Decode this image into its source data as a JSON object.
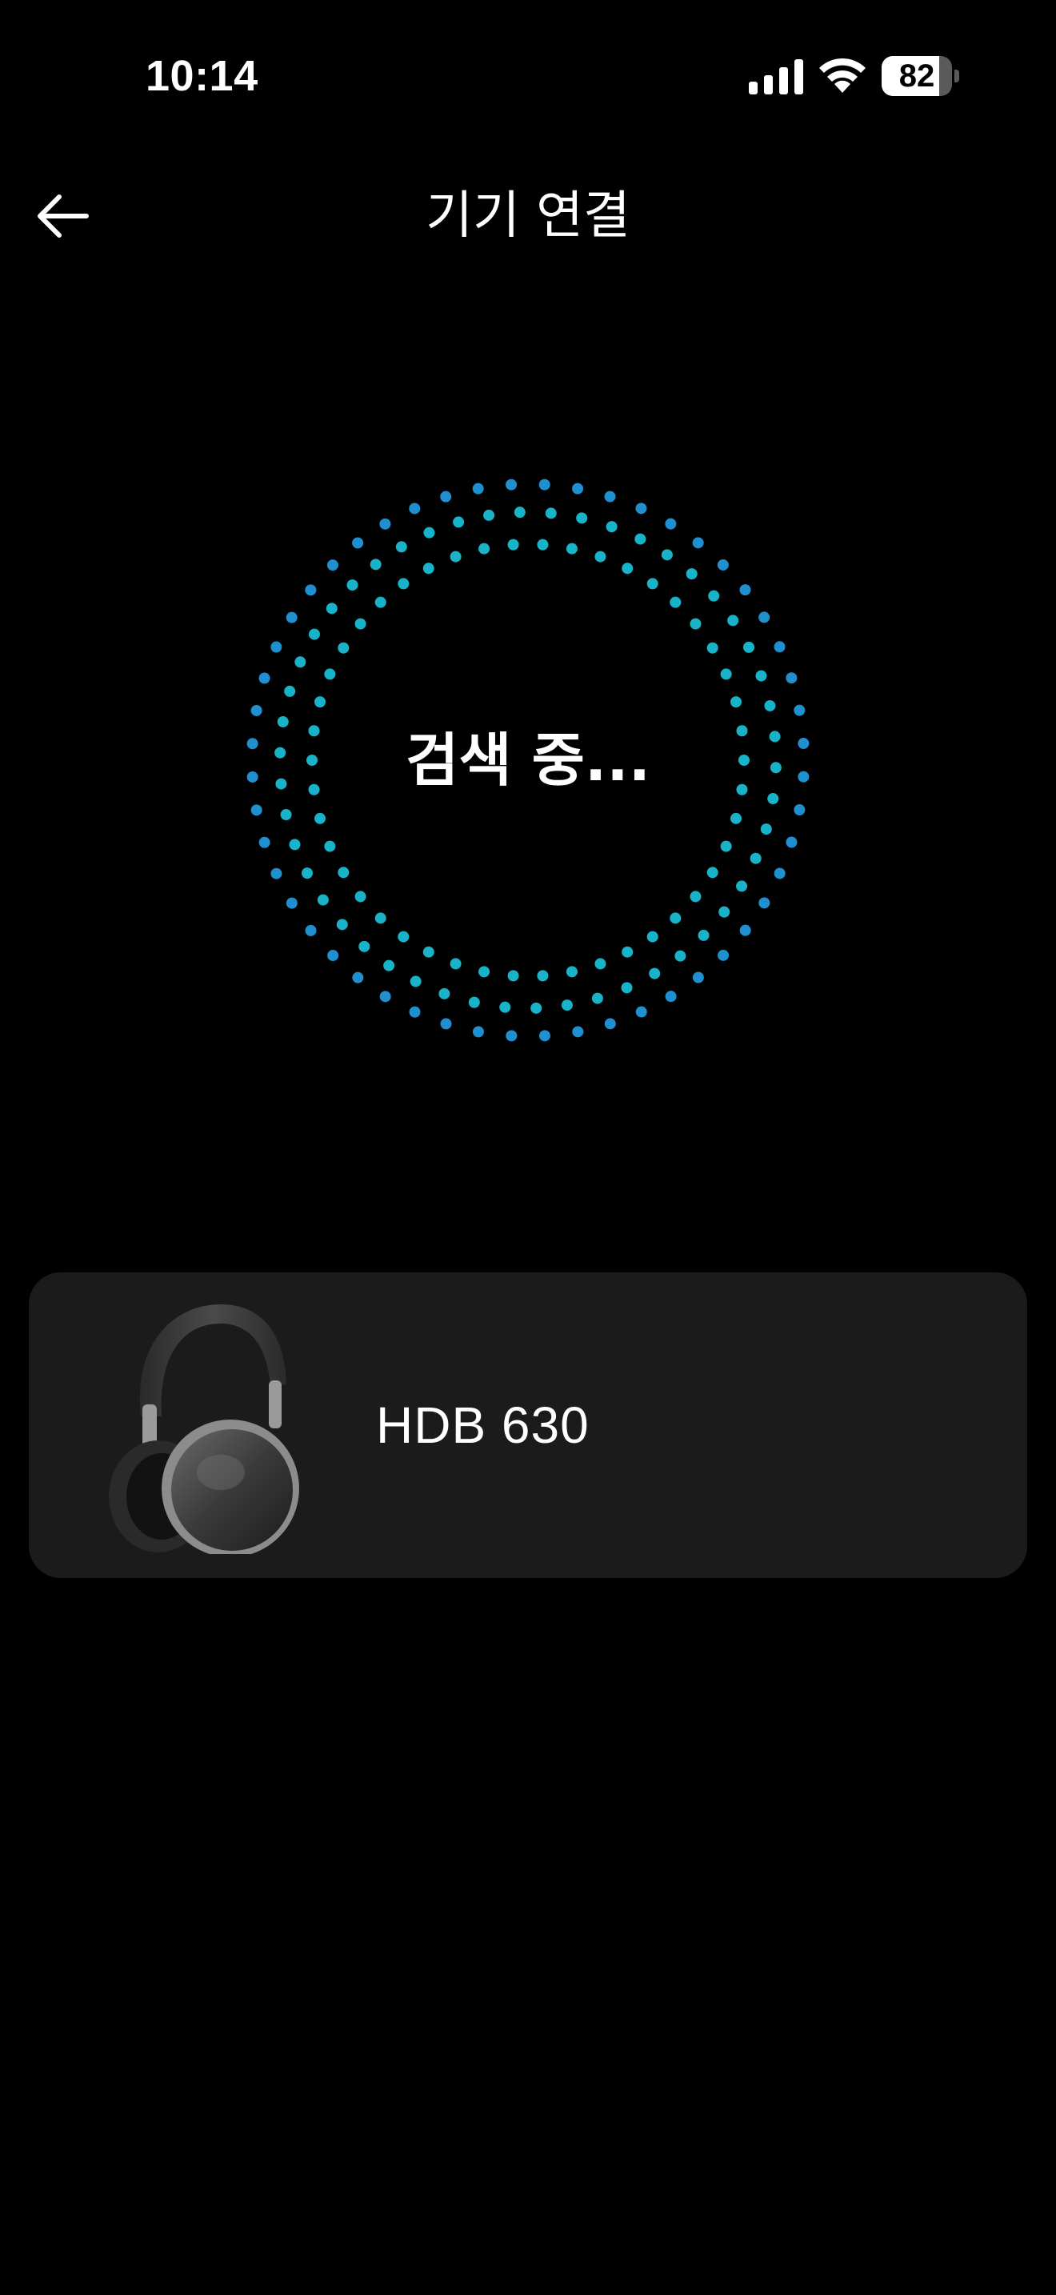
{
  "status_bar": {
    "time": "10:14",
    "battery_level": "82",
    "battery_fraction": 0.82,
    "icons": [
      "signal-icon",
      "wifi-icon",
      "battery-icon"
    ]
  },
  "header": {
    "title": "기기 연결",
    "back_icon": "arrow-left-icon"
  },
  "scan": {
    "status": "검색 중...",
    "animation_icon": "dotted-pulse-rings",
    "colors": {
      "inner": "#19b3c9",
      "outer": "#1f8fd0"
    }
  },
  "devices": [
    {
      "name": "HDB 630",
      "image_icon": "headphones-icon"
    }
  ],
  "colors": {
    "background": "#000000",
    "card": "#1b1b1b",
    "text": "#ffffff"
  }
}
